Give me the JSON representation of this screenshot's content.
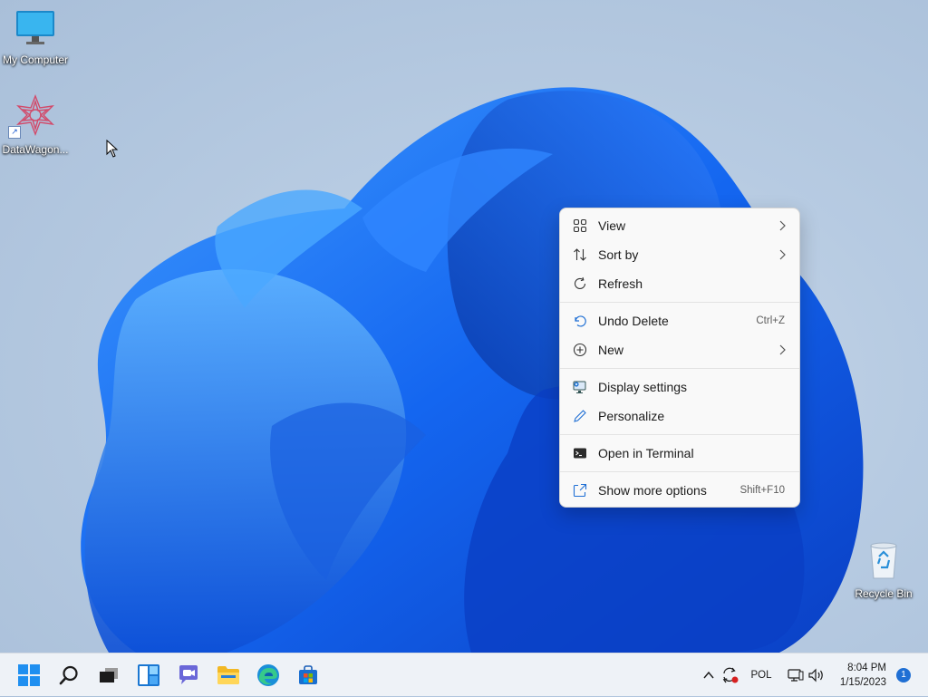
{
  "desktop": {
    "icons": [
      {
        "label": "My Computer",
        "icon": "monitor-icon"
      },
      {
        "label": "DataWagon...",
        "icon": "datawagon-app-icon"
      },
      {
        "label": "Recycle Bin",
        "icon": "recycle-bin-icon"
      }
    ]
  },
  "context_menu": {
    "items": [
      {
        "label": "View",
        "icon": "grid-view-icon",
        "has_submenu": true
      },
      {
        "label": "Sort by",
        "icon": "sort-icon",
        "has_submenu": true
      },
      {
        "label": "Refresh",
        "icon": "refresh-icon",
        "has_submenu": false
      },
      {
        "label": "Undo Delete",
        "icon": "undo-icon",
        "shortcut": "Ctrl+Z"
      },
      {
        "label": "New",
        "icon": "new-plus-icon",
        "has_submenu": true
      },
      {
        "label": "Display settings",
        "icon": "display-settings-icon"
      },
      {
        "label": "Personalize",
        "icon": "personalize-pen-icon"
      },
      {
        "label": "Open in Terminal",
        "icon": "terminal-icon"
      },
      {
        "label": "Show more options",
        "icon": "more-options-icon",
        "shortcut": "Shift+F10"
      }
    ]
  },
  "taskbar": {
    "buttons": [
      {
        "name": "start",
        "icon": "windows-start-icon"
      },
      {
        "name": "search",
        "icon": "search-icon"
      },
      {
        "name": "task-view",
        "icon": "task-view-icon"
      },
      {
        "name": "widgets",
        "icon": "widgets-icon"
      },
      {
        "name": "chat",
        "icon": "teams-chat-icon"
      },
      {
        "name": "file-explorer",
        "icon": "folder-icon"
      },
      {
        "name": "edge",
        "icon": "edge-browser-icon"
      },
      {
        "name": "store",
        "icon": "store-icon"
      }
    ],
    "tray": {
      "language": "POL",
      "time": "8:04 PM",
      "date": "1/15/2023",
      "notification_count": "1"
    }
  },
  "colors": {
    "accent": "#1f6fd4",
    "menu_bg": "#f9f9f9",
    "taskbar_bg": "#eef2f7"
  }
}
